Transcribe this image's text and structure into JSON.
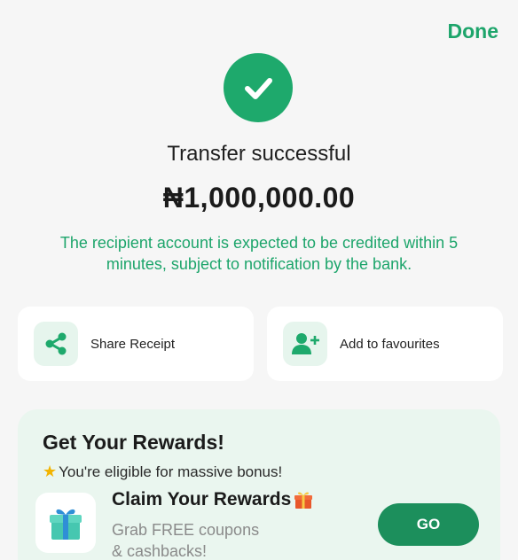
{
  "header": {
    "done_label": "Done"
  },
  "result": {
    "title": "Transfer successful",
    "amount": "₦1,000,000.00",
    "note": "The recipient account is expected to be credited within 5 minutes, subject to notification by the bank."
  },
  "actions": [
    {
      "label": "Share Receipt",
      "icon": "share-icon"
    },
    {
      "label": "Add to favourites",
      "icon": "add-user-icon"
    }
  ],
  "rewards": {
    "title": "Get Your Rewards!",
    "subtitle": "You're eligible for massive bonus!",
    "claim_title": "Claim Your Rewards",
    "claim_desc_line1": "Grab FREE coupons",
    "claim_desc_line2": "& cashbacks!",
    "go_label": "GO"
  },
  "colors": {
    "brand_green": "#1ea96c",
    "text_green": "#1da56b",
    "button_green": "#1c8f5c",
    "rewards_bg": "#eaf6ef"
  }
}
